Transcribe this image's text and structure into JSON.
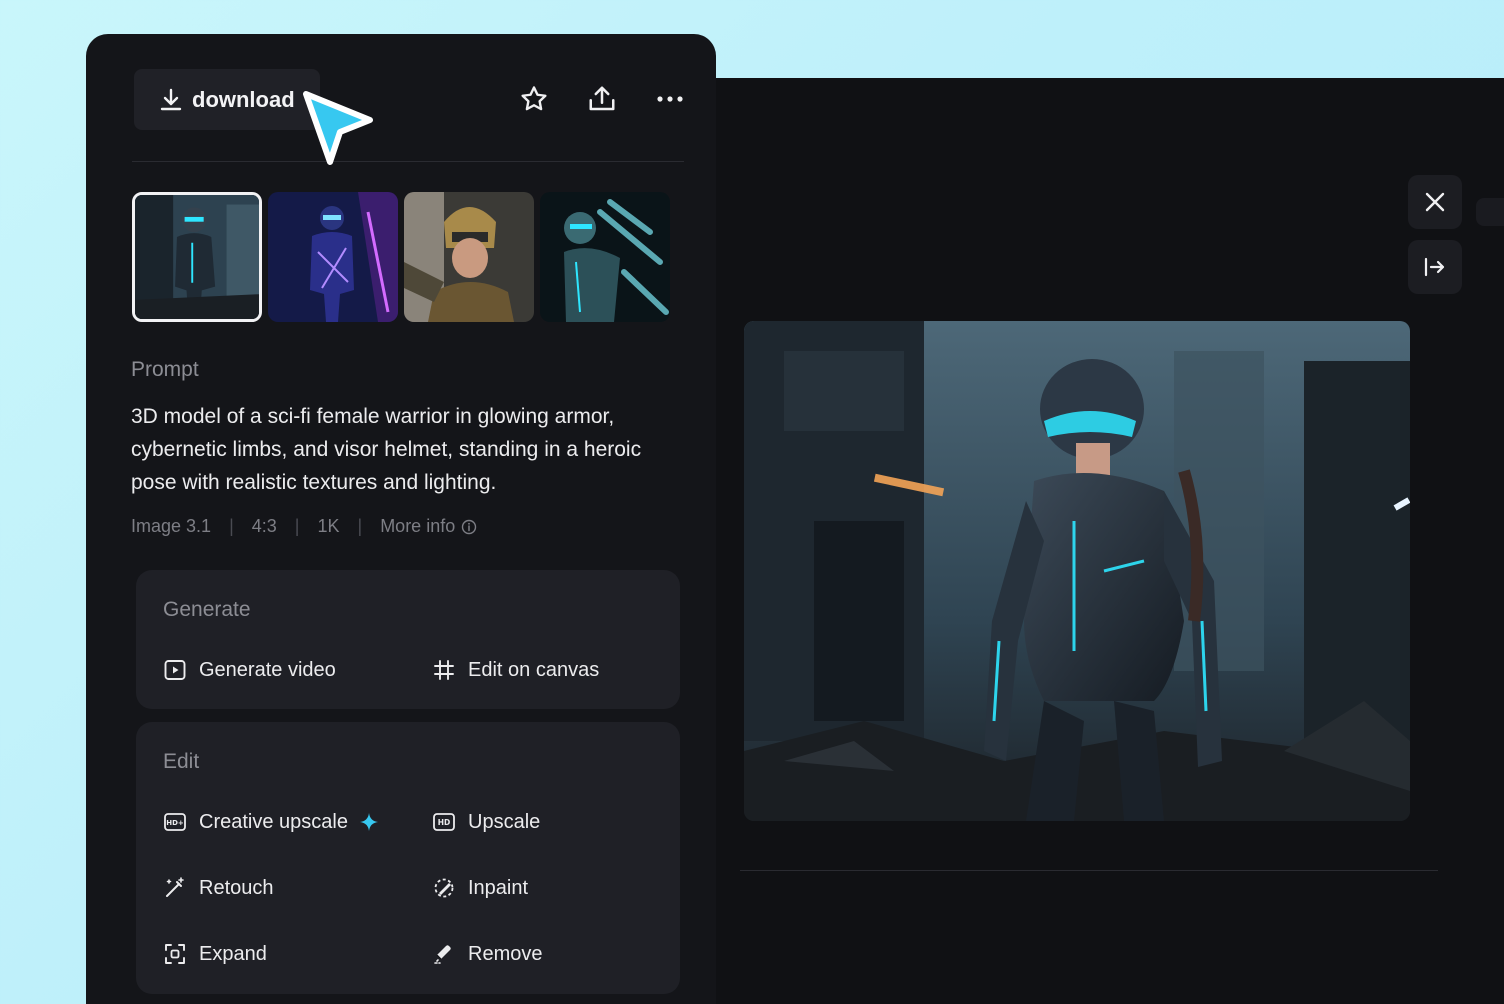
{
  "toolbar": {
    "download_label": "download"
  },
  "prompt": {
    "label": "Prompt",
    "text": "3D model of a sci-fi female warrior in glowing armor, cybernetic limbs, and visor helmet, standing in a heroic pose with realistic textures and lighting."
  },
  "meta": {
    "model": "Image 3.1",
    "ratio": "4:3",
    "resolution": "1K",
    "more_info": "More info"
  },
  "generate": {
    "title": "Generate",
    "video": "Generate video",
    "canvas": "Edit on canvas"
  },
  "edit": {
    "title": "Edit",
    "creative_upscale": "Creative upscale",
    "upscale": "Upscale",
    "retouch": "Retouch",
    "inpaint": "Inpaint",
    "expand": "Expand",
    "remove": "Remove"
  },
  "colors": {
    "accent": "#37c8f0",
    "panel": "#141519",
    "card": "#1f2026"
  }
}
